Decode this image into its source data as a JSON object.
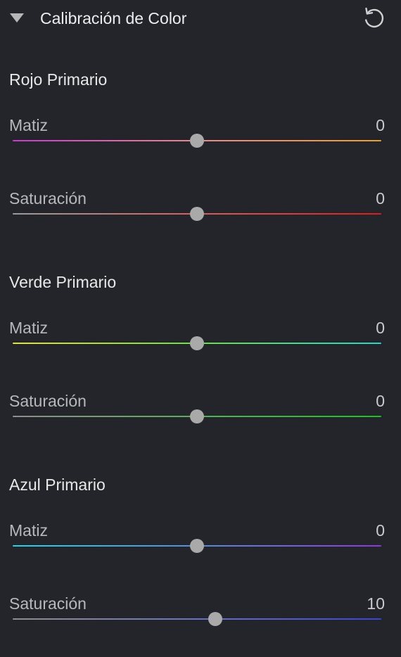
{
  "panel": {
    "title": "Calibración de Color",
    "collapse_icon": "triangle-down-icon",
    "reset_icon": "reset-icon"
  },
  "groups": [
    {
      "title": "Rojo Primario",
      "sliders": [
        {
          "label": "Matiz",
          "value": "0",
          "level": 0.5,
          "gradient": [
            "#c83ad0",
            "#e68a8a",
            "#e8a032"
          ]
        },
        {
          "label": "Saturación",
          "value": "0",
          "level": 0.5,
          "gradient": [
            "#9a9a9a",
            "#d26060",
            "#d81e1e"
          ]
        }
      ]
    },
    {
      "title": "Verde Primario",
      "sliders": [
        {
          "label": "Matiz",
          "value": "0",
          "level": 0.5,
          "gradient": [
            "#e8e22a",
            "#6ede4a",
            "#2ad6c8"
          ]
        },
        {
          "label": "Saturación",
          "value": "0",
          "level": 0.5,
          "gradient": [
            "#8e8e8e",
            "#58b058",
            "#1fbf2a"
          ]
        }
      ]
    },
    {
      "title": "Azul Primario",
      "sliders": [
        {
          "label": "Matiz",
          "value": "0",
          "level": 0.5,
          "gradient": [
            "#2ad2e2",
            "#5a8ad6",
            "#8a3ad6"
          ]
        },
        {
          "label": "Saturación",
          "value": "10",
          "level": 0.55,
          "gradient": [
            "#8e8e8e",
            "#6a72c4",
            "#3a44d8"
          ]
        }
      ]
    }
  ]
}
